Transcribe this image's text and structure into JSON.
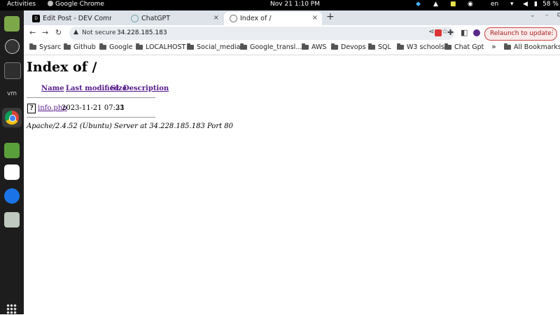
{
  "topbar": {
    "activities": "Activities",
    "app": "Google Chrome",
    "datetime": "Nov 21  1:10 PM",
    "lang": "en",
    "battery": "58 %"
  },
  "tabs": [
    {
      "label": "Edit Post - DEV Commun",
      "close": "×"
    },
    {
      "label": "ChatGPT",
      "close": "×"
    },
    {
      "label": "Index of /",
      "close": "×"
    }
  ],
  "new_tab": "+",
  "toolbar": {
    "security": "Not secure",
    "url": "34.228.185.183",
    "relaunch": "Relaunch to update"
  },
  "bookmarks": {
    "items": [
      "Sysarc",
      "Github",
      "Google",
      "LOCALHOST",
      "Social_media",
      "Google_transl...",
      "AWS",
      "Devops",
      "SQL",
      "W3 schools",
      "Chat Gpt"
    ],
    "overflow": "»",
    "all": "All Bookmarks"
  },
  "page": {
    "title": "Index of /",
    "columns": [
      "Name",
      "Last modified",
      "Size",
      "Description"
    ],
    "rows": [
      {
        "icon": "?",
        "name": "info.php",
        "modified": "2023-11-21 07:33",
        "size": "21",
        "description": ""
      }
    ],
    "footer": "Apache/2.4.52 (Ubuntu) Server at 34.228.185.183 Port 80"
  }
}
